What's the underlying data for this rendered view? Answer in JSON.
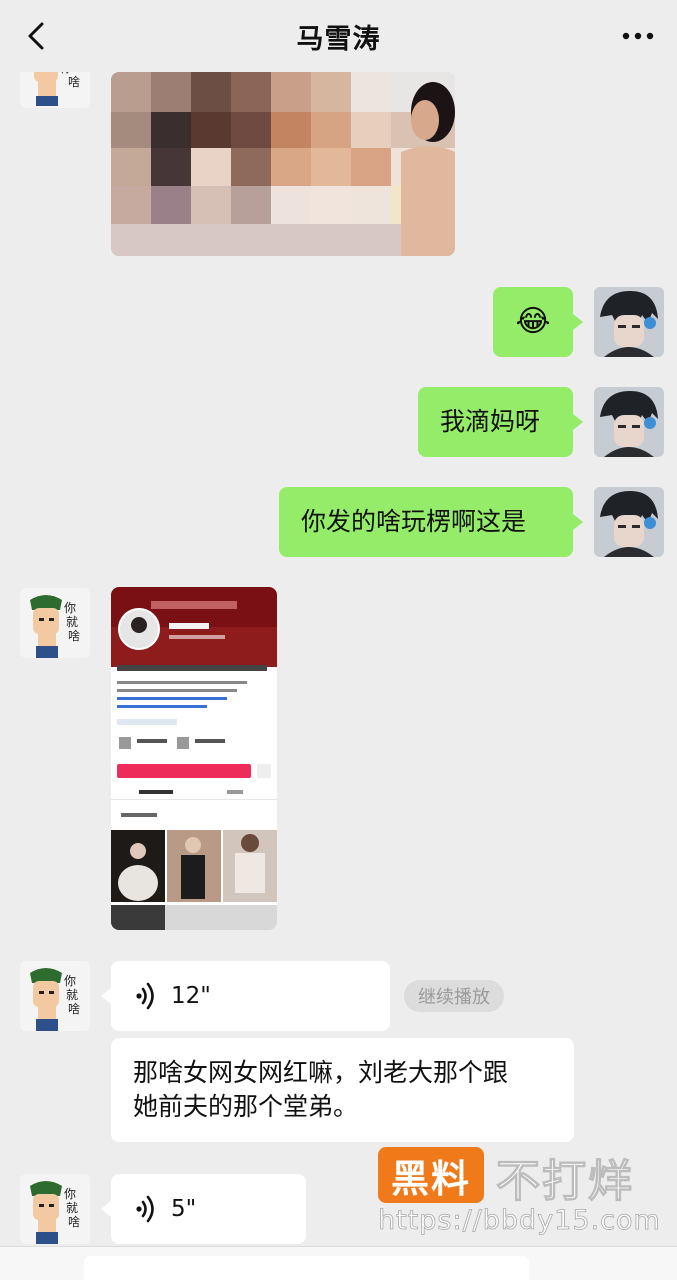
{
  "header": {
    "title": "马雪涛",
    "back_icon": "chevron-left-icon",
    "more_icon": "more-dots-icon"
  },
  "messages": [
    {
      "sender": "them",
      "type": "image",
      "content": "pixelated-photo"
    },
    {
      "sender": "me",
      "type": "emoji",
      "text": "😂"
    },
    {
      "sender": "me",
      "type": "text",
      "text": "我滴妈呀"
    },
    {
      "sender": "me",
      "type": "text",
      "text": "你发的啥玩楞啊这是"
    },
    {
      "sender": "them",
      "type": "image",
      "content": "profile-screenshot"
    },
    {
      "sender": "them",
      "type": "voice",
      "duration": "12\"",
      "action": "继续播放"
    },
    {
      "sender": "them",
      "type": "text",
      "text_line1": "那啥女网女网红嘛，刘老大那个跟",
      "text_line2": "她前夫的那个堂弟。"
    },
    {
      "sender": "them",
      "type": "voice",
      "duration": "5\""
    }
  ],
  "watermark": {
    "badge": "黑料",
    "text": "不打烊",
    "url": "https://bbdy15.com"
  },
  "colors": {
    "background": "#ededed",
    "my_bubble": "#95ec69",
    "their_bubble": "#ffffff",
    "watermark_orange": "#f07a1a"
  }
}
